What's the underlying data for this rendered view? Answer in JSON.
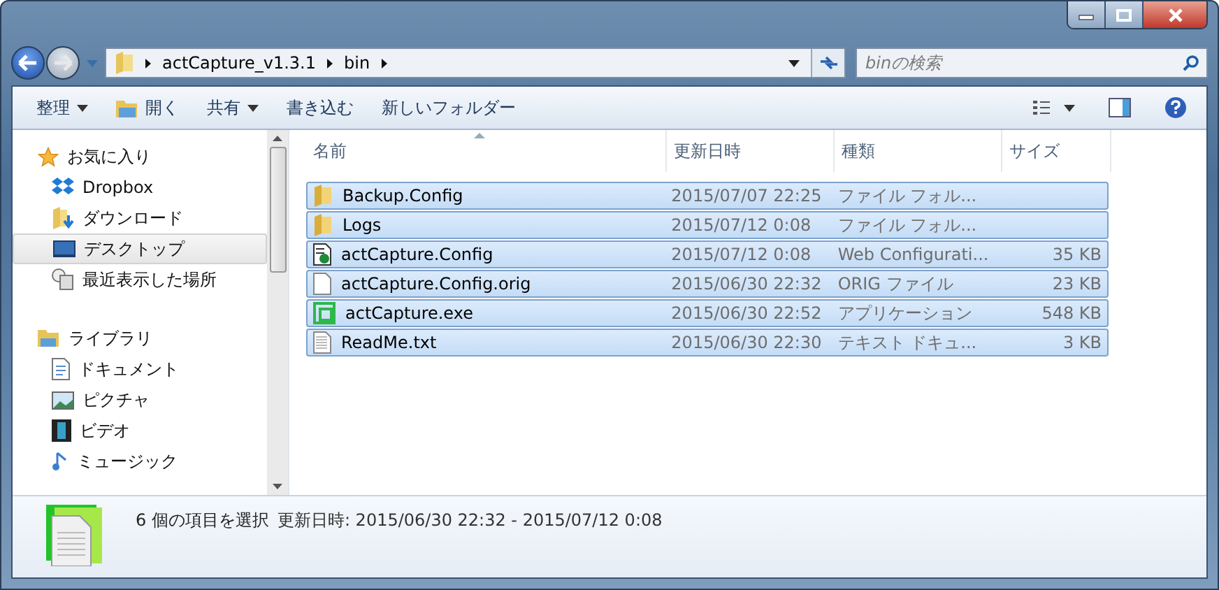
{
  "address_bar": {
    "path": [
      "actCapture_v1.3.1",
      "bin"
    ]
  },
  "search": {
    "placeholder": "binの検索"
  },
  "toolbar": [
    {
      "label": "整理",
      "kind": "menu"
    },
    {
      "label": "開く",
      "kind": "open"
    },
    {
      "label": "共有",
      "kind": "menu"
    },
    {
      "label": "書き込む",
      "kind": "plain"
    },
    {
      "label": "新しいフォルダー",
      "kind": "plain"
    }
  ],
  "sidebar": {
    "groups": [
      {
        "label": "お気に入り",
        "kind": "star",
        "children": [
          {
            "label": "Dropbox",
            "kind": "dropbox",
            "selected": false
          },
          {
            "label": "ダウンロード",
            "kind": "download",
            "selected": false
          },
          {
            "label": "デスクトップ",
            "kind": "desktop",
            "selected": true
          },
          {
            "label": "最近表示した場所",
            "kind": "recent",
            "selected": false
          }
        ]
      },
      {
        "label": "ライブラリ",
        "kind": "library",
        "children": [
          {
            "label": "ドキュメント",
            "kind": "document",
            "selected": false
          },
          {
            "label": "ピクチャ",
            "kind": "picture",
            "selected": false
          },
          {
            "label": "ビデオ",
            "kind": "video",
            "selected": false
          },
          {
            "label": "ミュージック",
            "kind": "music",
            "selected": false
          }
        ]
      }
    ]
  },
  "table": {
    "columns": [
      "名前",
      "更新日時",
      "種類",
      "サイズ"
    ],
    "rows": [
      {
        "name": "Backup.Config",
        "date": "2015/07/07 22:25",
        "type": "ファイル フォル...",
        "size": "",
        "kind": "folder",
        "selected": true
      },
      {
        "name": "Logs",
        "date": "2015/07/12 0:08",
        "type": "ファイル フォル...",
        "size": "",
        "kind": "folder",
        "selected": true
      },
      {
        "name": "actCapture.Config",
        "date": "2015/07/12 0:08",
        "type": "Web Configurati...",
        "size": "35 KB",
        "kind": "config",
        "selected": true
      },
      {
        "name": "actCapture.Config.orig",
        "date": "2015/06/30 22:32",
        "type": "ORIG ファイル",
        "size": "23 KB",
        "kind": "file",
        "selected": true
      },
      {
        "name": "actCapture.exe",
        "date": "2015/06/30 22:52",
        "type": "アプリケーション",
        "size": "548 KB",
        "kind": "exe",
        "selected": true
      },
      {
        "name": "ReadMe.txt",
        "date": "2015/06/30 22:30",
        "type": "テキスト ドキュ...",
        "size": "3 KB",
        "kind": "text",
        "selected": true
      }
    ]
  },
  "status_bar": {
    "selection": "6 個の項目を選択",
    "modified": "更新日時: 2015/06/30 22:32 - 2015/07/12 0:08"
  }
}
